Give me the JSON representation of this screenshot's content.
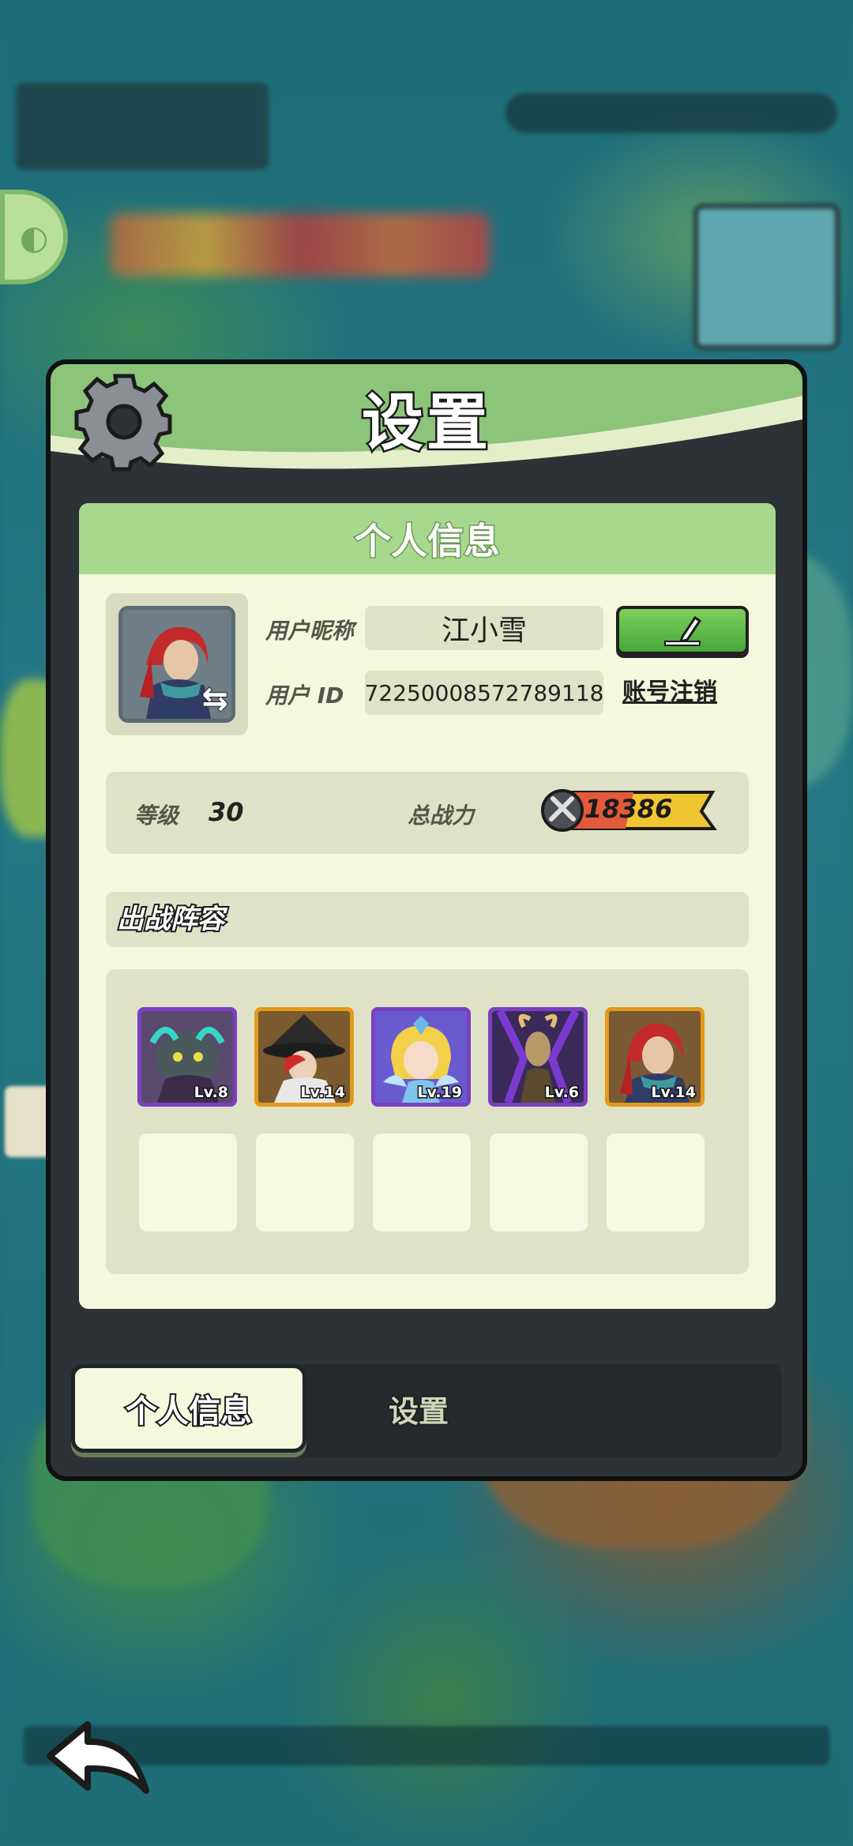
{
  "panel": {
    "title": "设置",
    "card_title": "个人信息"
  },
  "profile": {
    "nickname_label": "用户昵称",
    "nickname": "江小雪",
    "id_label": "用户 ID",
    "user_id": "72250008572789118",
    "account_link": "账号注销"
  },
  "stats": {
    "level_label": "等级",
    "level": "30",
    "power_label": "总战力",
    "power": "18386"
  },
  "lineup": {
    "title": "出战阵容",
    "heroes": [
      {
        "level": "Lv.8",
        "frame": "purple"
      },
      {
        "level": "Lv.14",
        "frame": "orange"
      },
      {
        "level": "Lv.19",
        "frame": "purple"
      },
      {
        "level": "Lv.6",
        "frame": "purple"
      },
      {
        "level": "Lv.14",
        "frame": "orange"
      }
    ]
  },
  "tabs": {
    "profile": "个人信息",
    "settings": "设置"
  },
  "colors": {
    "header_green": "#8cc47a",
    "card_bg": "#f4f8dc",
    "accent_green": "#48a63a",
    "purple_frame": "#7a3fc0",
    "orange_frame": "#e39a1a"
  }
}
